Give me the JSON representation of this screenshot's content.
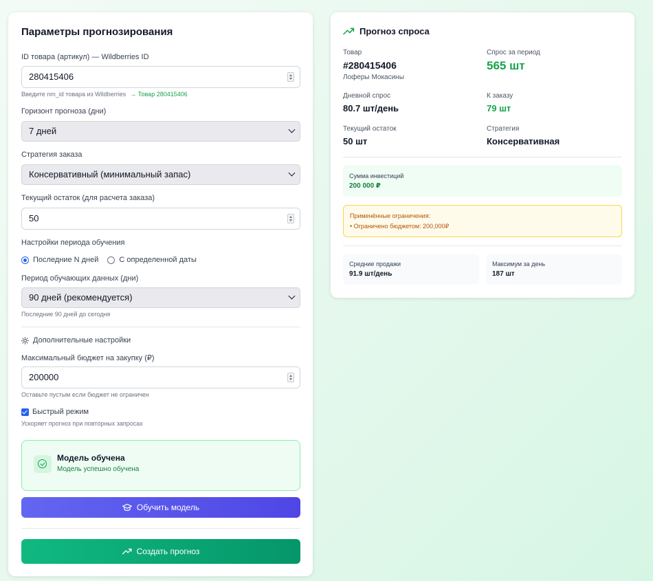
{
  "params": {
    "title": "Параметры прогнозирования",
    "product_id_label": "ID товара (артикул) — Wildberries ID",
    "product_id_value": "280415406",
    "product_id_hint": "Введите nm_id товара из Wildberries",
    "product_id_found": "→ Товар 280415406",
    "horizon_label": "Горизонт прогноза (дни)",
    "horizon_value": "7 дней",
    "strategy_label": "Стратегия заказа",
    "strategy_value": "Консервативный (минимальный запас)",
    "stock_label": "Текущий остаток (для расчета заказа)",
    "stock_value": "50",
    "training_settings_label": "Настройки периода обучения",
    "radio_last_n": "Последние N дней",
    "radio_from_date": "С определенной даты",
    "period_label": "Период обучающих данных (дни)",
    "period_value": "90 дней (рекомендуется)",
    "period_hint": "Последние 90 дней до сегодня",
    "advanced_label": "Дополнительные настройки",
    "budget_label": "Максимальный бюджет на закупку (₽)",
    "budget_value": "200000",
    "budget_hint": "Оставьте пустым если бюджет не ограничен",
    "fast_mode_label": "Быстрый режим",
    "fast_mode_hint": "Ускоряет прогноз при повторных запросах",
    "model_status_title": "Модель обучена",
    "model_status_sub": "Модель успешно обучена",
    "train_button": "Обучить модель",
    "create_button": "Создать прогноз"
  },
  "forecast": {
    "title": "Прогноз спроса",
    "product_label": "Товар",
    "product_value": "#280415406",
    "product_name": "Лоферы Мокасины",
    "period_demand_label": "Спрос за период",
    "period_demand_value": "565 шт",
    "daily_demand_label": "Дневной спрос",
    "daily_demand_value": "80.7 шт/день",
    "to_order_label": "К заказу",
    "to_order_value": "79 шт",
    "stock_label": "Текущий остаток",
    "stock_value": "50 шт",
    "strategy_label": "Стратегия",
    "strategy_value": "Консервативная",
    "investment_label": "Сумма инвестиций",
    "investment_value": "200 000 ₽",
    "limits_title": "Применённые ограничения:",
    "limits_item": "• Ограничено бюджетом: 200,000₽",
    "avg_sales_label": "Средние продажи",
    "avg_sales_value": "91.9 шт/день",
    "max_day_label": "Максимум за день",
    "max_day_value": "187 шт"
  },
  "colors": {
    "accent_green": "#16a34a",
    "train_button": "#4f46e5",
    "create_button": "#10b981",
    "warning": "#b45309"
  },
  "icons": {
    "trend": "trending-up-icon",
    "gear": "gear-icon",
    "check": "check-circle-icon",
    "cap": "graduation-cap-icon"
  }
}
